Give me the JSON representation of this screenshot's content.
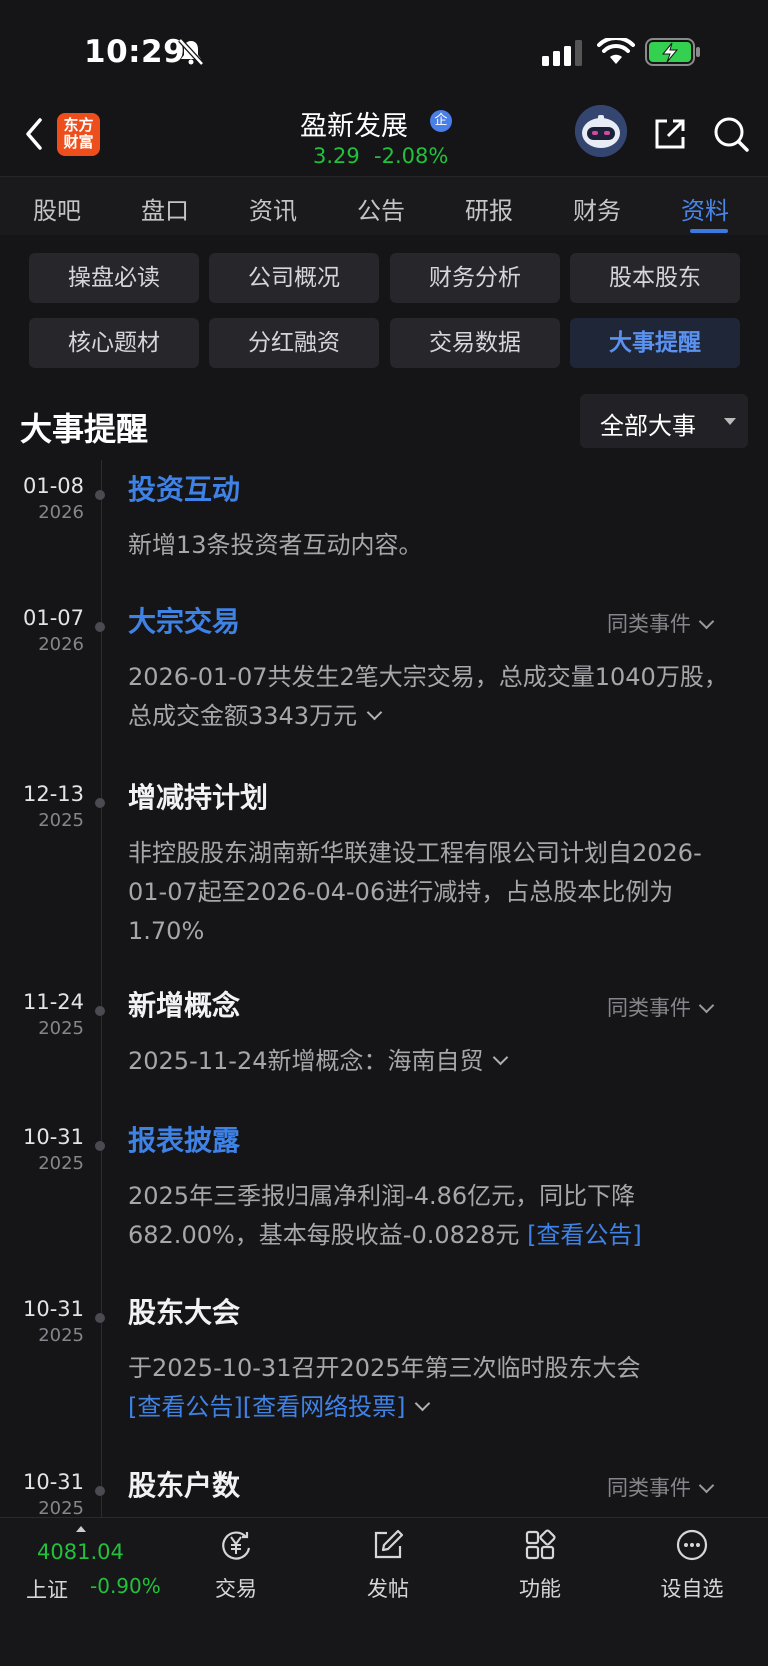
{
  "status": {
    "time": "10:29"
  },
  "header": {
    "logo_line1": "东方",
    "logo_line2": "财富",
    "stock_name": "盈新发展",
    "badge": "企",
    "price": "3.29",
    "change": "-2.08%"
  },
  "tabs": [
    "股吧",
    "盘口",
    "资讯",
    "公告",
    "研报",
    "财务",
    "资料"
  ],
  "active_tab": "资料",
  "subnav": [
    "操盘必读",
    "公司概况",
    "财务分析",
    "股本股东",
    "核心题材",
    "分红融资",
    "交易数据",
    "大事提醒"
  ],
  "active_subnav": "大事提醒",
  "section": {
    "title": "大事提醒",
    "filter": "全部大事"
  },
  "similar_label": "同类事件",
  "events": [
    {
      "date": "01-08",
      "year": "2026",
      "title": "投资互动",
      "body": "新增13条投资者互动内容。"
    },
    {
      "date": "01-07",
      "year": "2026",
      "title": "大宗交易",
      "body": "2026-01-07共发生2笔大宗交易，总成交量1040万股，总成交金额3343万元"
    },
    {
      "date": "12-13",
      "year": "2025",
      "title": "增减持计划",
      "body": "非控股股东湖南新华联建设工程有限公司计划自2026-01-07起至2026-04-06进行减持，占总股本比例为1.70%"
    },
    {
      "date": "11-24",
      "year": "2025",
      "title": "新增概念",
      "body": "2025-11-24新增概念：海南自贸"
    },
    {
      "date": "10-31",
      "year": "2025",
      "title": "报表披露",
      "body": "2025年三季报归属净利润-4.86亿元，同比下降682.00%，基本每股收益-0.0828元",
      "link": "[查看公告]"
    },
    {
      "date": "10-31",
      "year": "2025",
      "title": "股东大会",
      "body": "于2025-10-31召开2025年第三次临时股东大会",
      "link1": "[查看公告]",
      "link2": "[查看网络投票]"
    },
    {
      "date": "10-31",
      "year": "2025",
      "title": "股东户数"
    }
  ],
  "bottom": {
    "index_value": "4081.04",
    "index_name": "上证",
    "index_change": "-0.90%",
    "items": [
      "交易",
      "发帖",
      "功能",
      "设自选"
    ]
  }
}
